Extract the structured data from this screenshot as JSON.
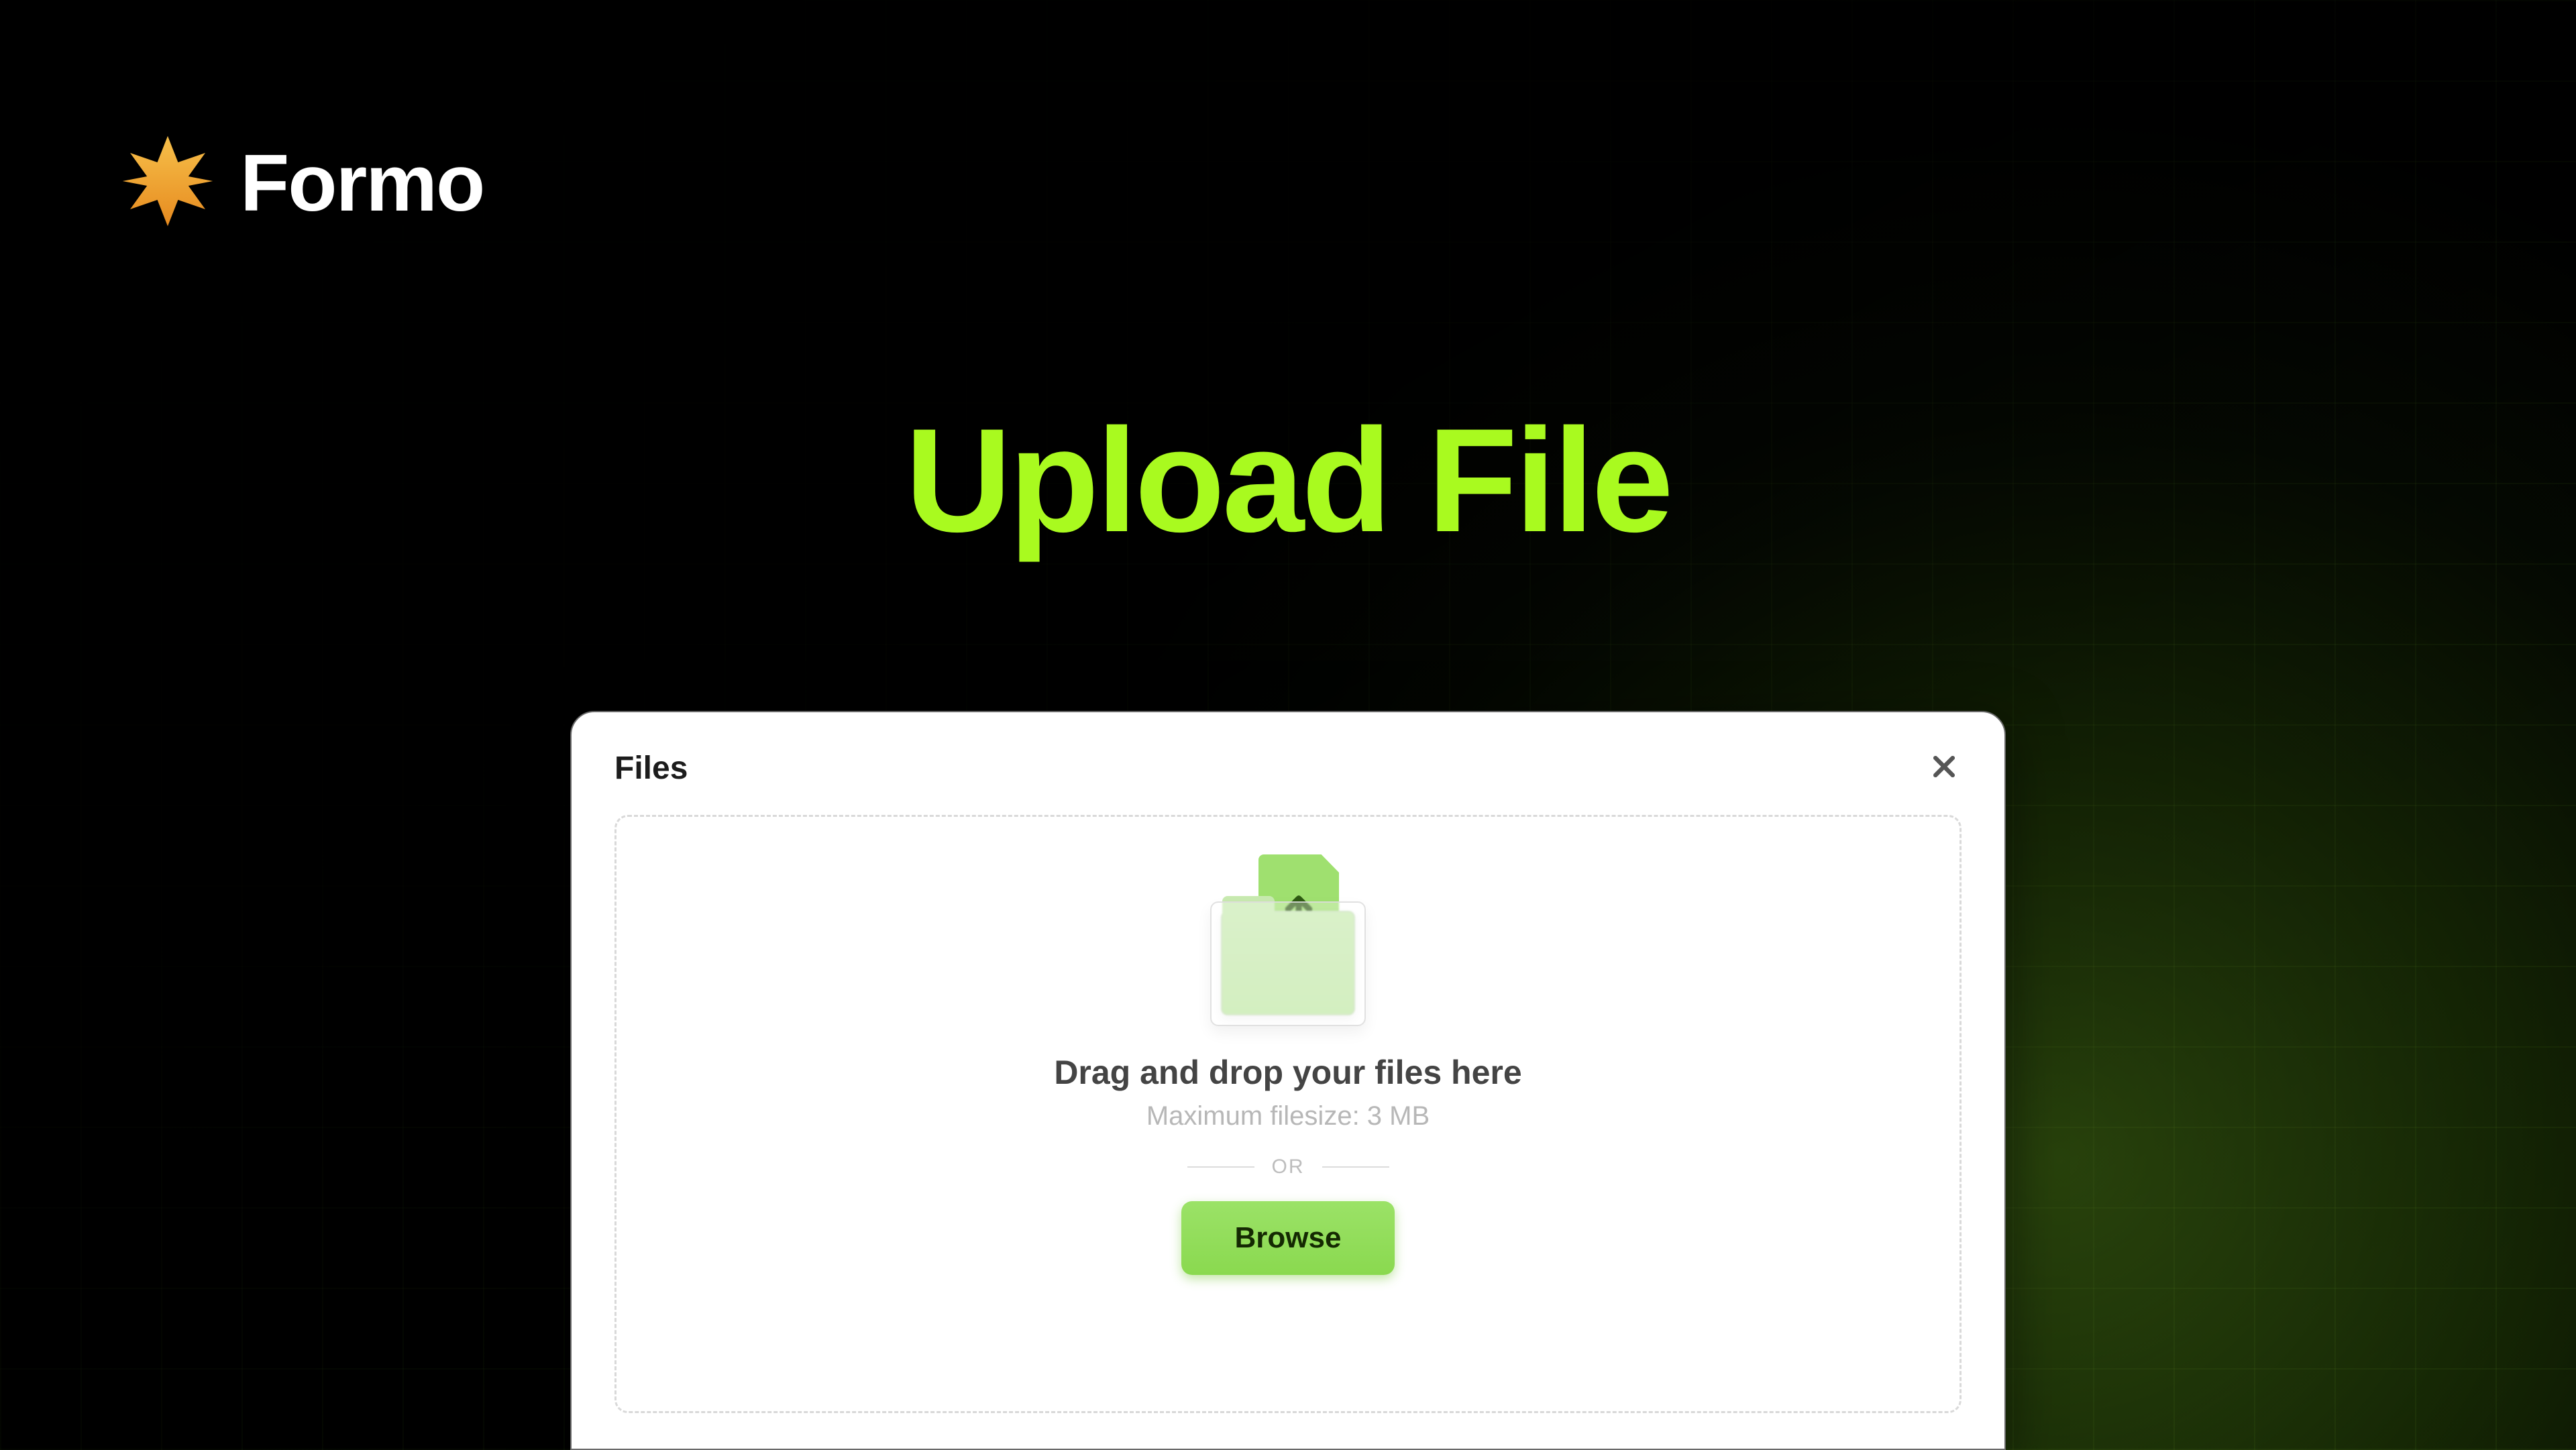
{
  "brand": {
    "name": "Formo"
  },
  "page": {
    "title": "Upload File"
  },
  "card": {
    "title": "Files",
    "dropzone": {
      "primary": "Drag and drop your files here",
      "secondary": "Maximum filesize: 3 MB",
      "separator": "OR",
      "browse": "Browse"
    }
  },
  "colors": {
    "accent": "#A9FA1F",
    "button": "#8AD94F"
  }
}
